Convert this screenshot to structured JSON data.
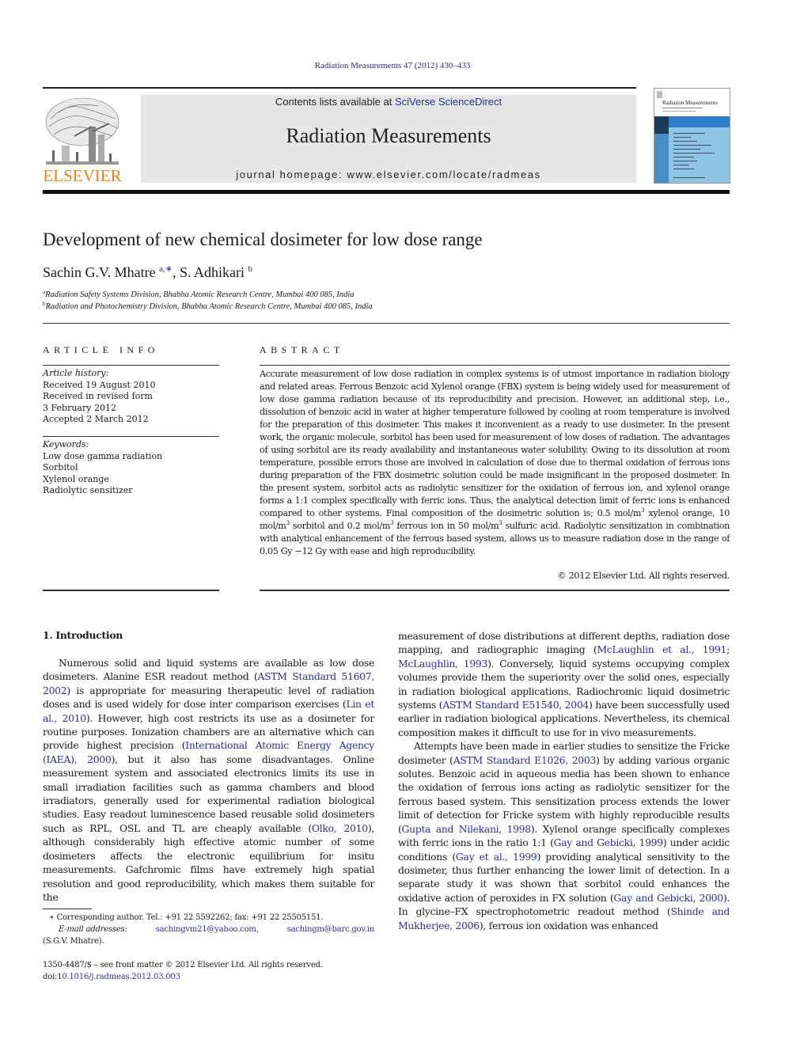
{
  "header": {
    "citation": "Radiation Measurements 47 (2012) 430–433",
    "contents_prefix": "Contents lists available at ",
    "contents_link": "SciVerse ScienceDirect",
    "journal_title": "Radiation Measurements",
    "homepage": "journal homepage: www.elsevier.com/locate/radmeas",
    "publisher_logo": "ELSEVIER",
    "cover_title": "Radiation Measurements",
    "brand_orange": "#f07f1a",
    "link_color": "#2b2e8c"
  },
  "article": {
    "title": "Development of new chemical dosimeter for low dose range",
    "authors": [
      {
        "name": "Sachin G.V. Mhatre",
        "marks": "a,∗"
      },
      {
        "name": "S. Adhikari",
        "marks": "b"
      }
    ],
    "author_separator": ", ",
    "affiliations": [
      {
        "mark": "a",
        "text": "Radiation Safety Systems Division, Bhabha Atomic Research Centre, Mumbai 400 085, India"
      },
      {
        "mark": "b",
        "text": "Radiation and Photochemistry Division, Bhabha Atomic Research Centre, Mumbai 400 085, India"
      }
    ]
  },
  "article_info": {
    "heading": "ARTICLE INFO",
    "history_label": "Article history:",
    "history": [
      "Received 19 August 2010",
      "Received in revised form",
      "3 February 2012",
      "Accepted 2 March 2012"
    ],
    "keywords_label": "Keywords:",
    "keywords": [
      "Low dose gamma radiation",
      "Sorbitol",
      "Xylenol orange",
      "Radiolytic sensitizer"
    ]
  },
  "abstract": {
    "heading": "ABSTRACT",
    "part1": "Accurate measurement of low dose radiation in complex systems is of utmost importance in radiation biology and related areas. Ferrous Benzoic acid Xylenol orange (FBX) system is being widely used for measurement of low dose gamma radiation because of its reproducibility and precision. However, an additional step, i.e., dissolution of benzoic acid in water at higher temperature followed by cooling at room temperature is involved for the preparation of this dosimeter. This makes it inconvenient as a ready to use dosimeter. In the present work, the organic molecule, sorbitol has been used for measurement of low doses of radiation. The advantages of using sorbitol are its ready availability and instantaneous water solubility. Owing to its dissolution at room temperature, possible errors those are involved in calculation of dose due to thermal oxidation of ferrous ions during preparation of the FBX dosimetric solution could be made insignificant in the proposed dosimeter. In the present system, sorbitol acts as radiolytic sensitizer for the oxidation of ferrous ion, and xylenol orange forms a 1:1 complex specifically with ferric ions. Thus, the analytical detection limit of ferric ions is enhanced compared to other systems. Final composition of the dosimetric solution is; 0.5 mol/m",
    "sup": "3",
    "part2": " xylenol orange, 10 mol/m",
    "part3": " sorbitol and 0.2 mol/m",
    "part4": " ferrous ion in 50 mol/m",
    "part5": " sulfuric acid. Radiolytic sensitization in combination with analytical enhancement of the ferrous based system, allows us to measure radiation dose in the range of 0.05 Gy −12 Gy with ease and high reproducibility.",
    "copyright": "© 2012 Elsevier Ltd. All rights reserved."
  },
  "body": {
    "section_heading": "1.  Introduction",
    "left": {
      "t1": "Numerous solid and liquid systems are available as low dose dosimeters. Alanine ESR readout method (",
      "r1": "ASTM Standard 51607, 2002",
      "t2": ") is appropriate for measuring therapeutic level of radiation doses and is used widely for dose inter comparison exercises (",
      "r2": "Lin et al., 2010",
      "t3": "). However, high cost restricts its use as a dosimeter for routine purposes. Ionization chambers are an alternative which can provide highest precision (",
      "r3": "International Atomic Energy Agency (IAEA), 2000",
      "t4": "), but it also has some disadvantages. Online measurement system and associated electronics limits its use in small irradiation facilities such as gamma chambers and blood irradiators, generally used for experimental radiation biological studies. Easy readout luminescence based reusable solid dosimeters such as RPL, OSL and TL are cheaply available (",
      "r4": "Olko, 2010",
      "t5": "), although considerably high effective atomic number of some dosimeters affects the electronic equilibrium for insitu measurements. Gafchromic films have extremely high spatial resolution and good reproducibility, which makes them suitable for the"
    },
    "right_p1": {
      "t1": "measurement of dose distributions at different depths, radiation dose mapping, and radiographic imaging (",
      "r1": "McLaughlin et al., 1991",
      "t2": "; ",
      "r2": "McLaughlin, 1993",
      "t3": "). Conversely, liquid systems occupying complex volumes provide them the superiority over the solid ones, especially in radiation biological applications. Radiochromic liquid dosimetric systems (",
      "r3": "ASTM Standard E51540, 2004",
      "t4": ") have been successfully used earlier in radiation biological applications. Nevertheless, its chemical composition makes it difficult to use for in vivo measurements."
    },
    "right_p2": {
      "t1": "Attempts have been made in earlier studies to sensitize the Fricke dosimeter (",
      "r1": "ASTM Standard E1026, 2003",
      "t2": ") by adding various organic solutes. Benzoic acid in aqueous media has been shown to enhance the oxidation of ferrous ions acting as radiolytic sensitizer for the ferrous based system. This sensitization process extends the lower limit of detection for Fricke system with highly reproducible results (",
      "r2": "Gupta and Nilekani, 1998",
      "t3": "). Xylenol orange specifically complexes with ferric ions in the ratio 1:1 (",
      "r3": "Gay and Gebicki, 1999",
      "t4": ") under acidic conditions (",
      "r4": "Gay et al., 1999",
      "t5": ") providing analytical sensitivity to the dosimeter, thus further enhancing the lower limit of detection. In a separate study it was shown that sorbitol could enhances the oxidative action of peroxides in FX solution (",
      "r5": "Gay and Gebicki, 2000",
      "t6": "). In glycine–FX spectrophotometric readout method (",
      "r6": "Shinde and Mukherjee, 2006",
      "t7": "), ferrous ion oxidation was enhanced"
    }
  },
  "footnotes": {
    "corresponding": "∗ Corresponding author. Tel.: +91 22 5592262; fax: +91 22 25505151.",
    "email_label": "E-mail addresses:",
    "email1": "sachingvm21@yahoo.com,",
    "email2": "sachingm@barc.gov.in",
    "email_owner": "(S.G.V. Mhatre).",
    "front_matter": "1350-4487/$ – see front matter © 2012 Elsevier Ltd. All rights reserved.",
    "doi_prefix": "doi:",
    "doi": "10.1016/j.radmeas.2012.03.003"
  }
}
